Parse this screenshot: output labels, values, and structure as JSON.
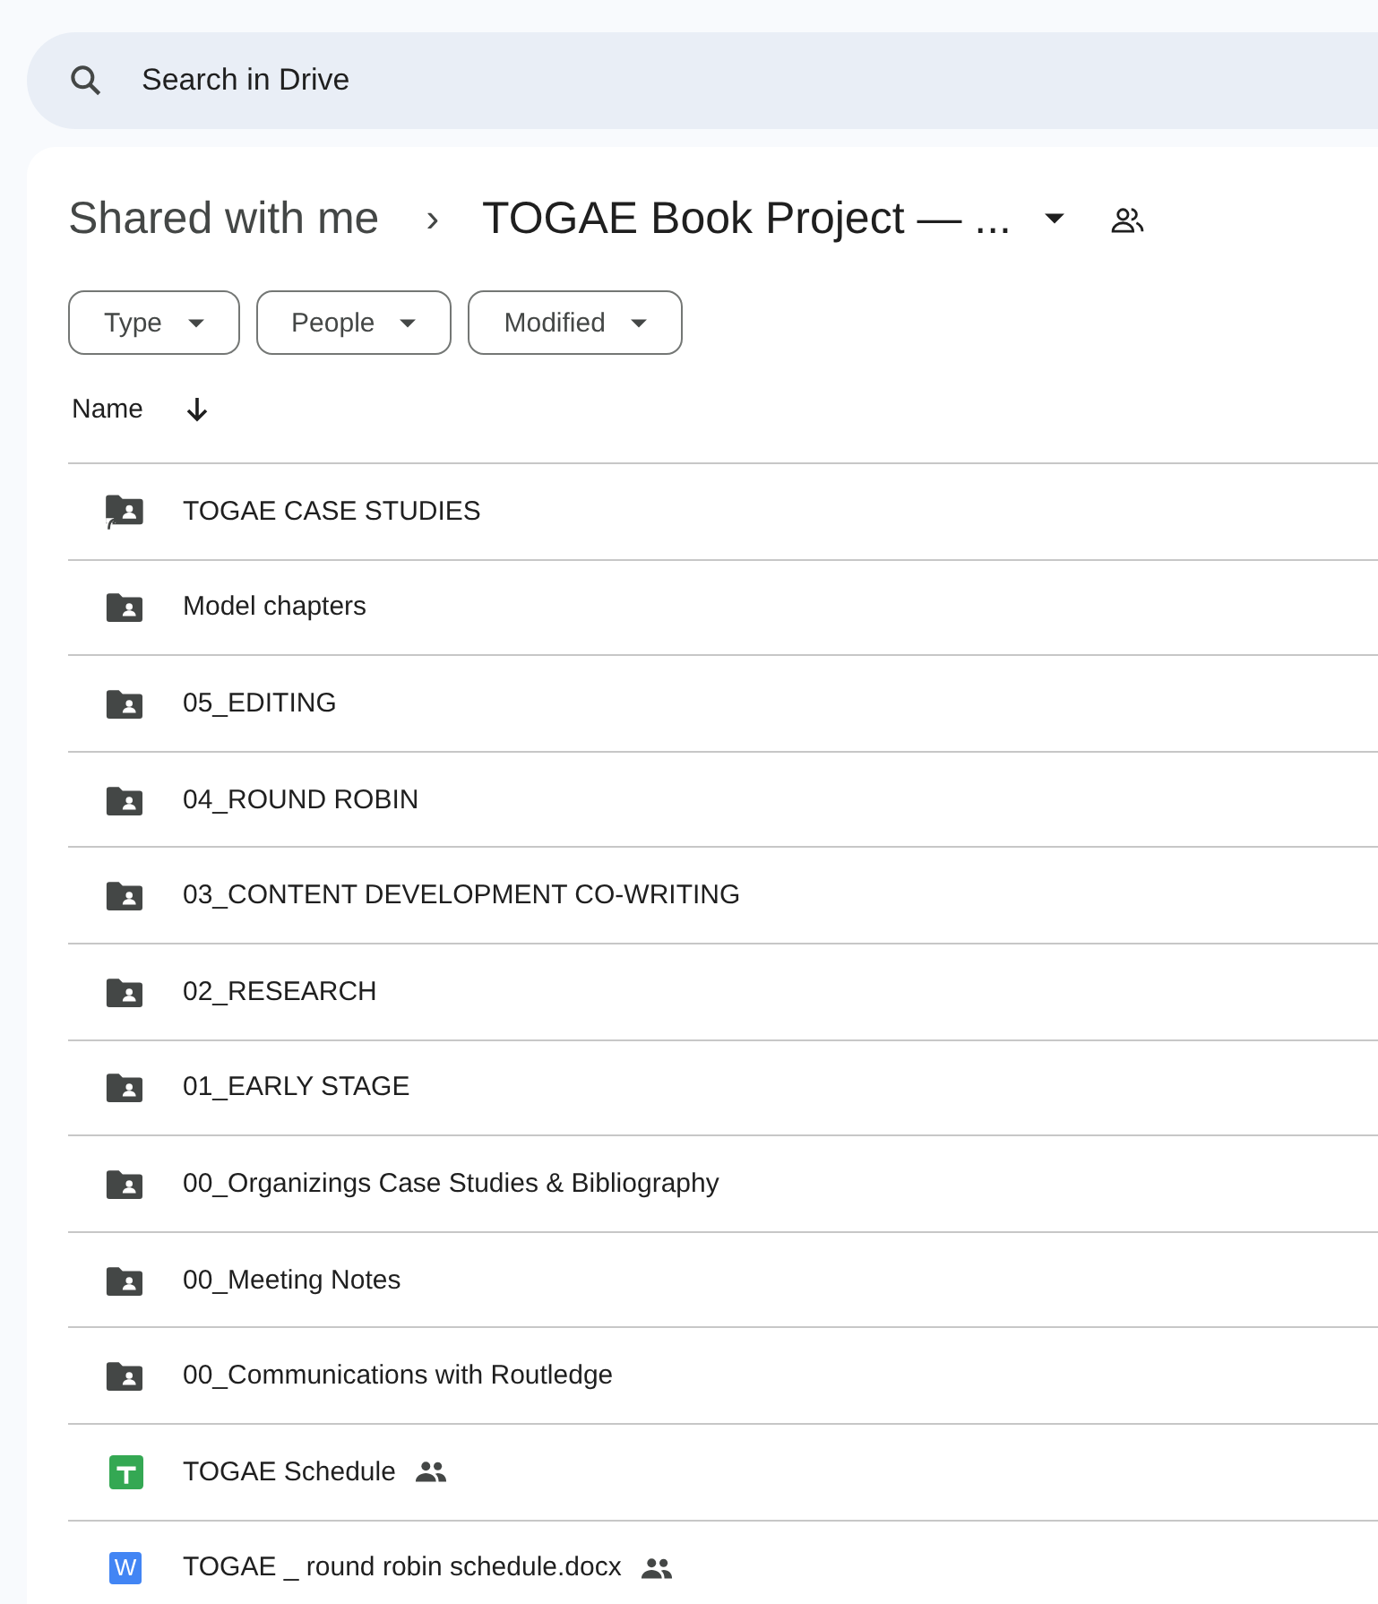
{
  "search": {
    "placeholder": "Search in Drive"
  },
  "breadcrumb": {
    "parent": "Shared with me",
    "separator": "›",
    "current": "TOGAE Book Project — ..."
  },
  "filters": [
    {
      "label": "Type"
    },
    {
      "label": "People"
    },
    {
      "label": "Modified"
    }
  ],
  "table": {
    "columns": [
      {
        "label": "Name",
        "sorted_descending": true
      }
    ],
    "rows": [
      {
        "name": "TOGAE CASE STUDIES",
        "kind": "shortcut",
        "shared": false
      },
      {
        "name": "Model chapters",
        "kind": "folder",
        "shared": false
      },
      {
        "name": "05_EDITING",
        "kind": "folder",
        "shared": false
      },
      {
        "name": "04_ROUND ROBIN",
        "kind": "folder",
        "shared": false
      },
      {
        "name": "03_CONTENT DEVELOPMENT CO-WRITING",
        "kind": "folder",
        "shared": false
      },
      {
        "name": "02_RESEARCH",
        "kind": "folder",
        "shared": false
      },
      {
        "name": "01_EARLY STAGE",
        "kind": "folder",
        "shared": false
      },
      {
        "name": "00_Organizings Case Studies & Bibliography",
        "kind": "folder",
        "shared": false
      },
      {
        "name": "00_Meeting Notes",
        "kind": "folder",
        "shared": false
      },
      {
        "name": "00_Communications with Routledge",
        "kind": "folder",
        "shared": false
      },
      {
        "name": "TOGAE Schedule",
        "kind": "sheet",
        "shared": true
      },
      {
        "name": "TOGAE _ round robin schedule.docx",
        "kind": "word",
        "icon_letter": "W",
        "shared": true
      }
    ]
  }
}
